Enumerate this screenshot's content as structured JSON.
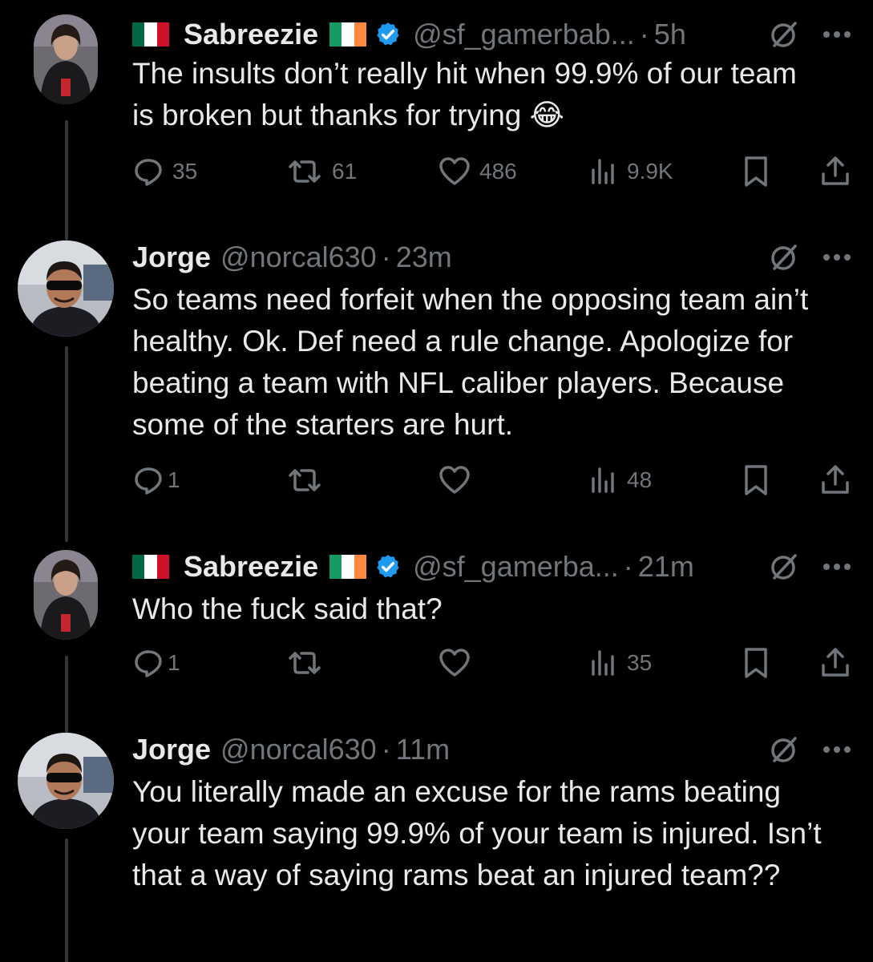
{
  "tweets": [
    {
      "display_name": "Sabreezie",
      "handle": "@sf_gamerbab...",
      "separator": "·",
      "time": "5h",
      "text": "The insults don’t really hit when 99.9% of our team is broken but thanks for trying 😂",
      "replies": "35",
      "reposts": "61",
      "likes": "486",
      "views": "9.9K"
    },
    {
      "display_name": "Jorge",
      "handle": "@norcal630",
      "separator": "·",
      "time": "23m",
      "text": "So teams need forfeit when the opposing team ain’t healthy. Ok. Def need a rule change. Apologize for beating a team with NFL caliber players. Because some of the starters are hurt.",
      "replies": "1",
      "reposts": "",
      "likes": "",
      "views": "48"
    },
    {
      "display_name": "Sabreezie",
      "handle": "@sf_gamerba...",
      "separator": "·",
      "time": "21m",
      "text": "Who the fuck said that?",
      "replies": "1",
      "reposts": "",
      "likes": "",
      "views": "35"
    },
    {
      "display_name": "Jorge",
      "handle": "@norcal630",
      "separator": "·",
      "time": "11m",
      "text": "You literally made an excuse for the rams beating your team saying 99.9% of your team is injured. Isn’t that a way of saying rams beat an injured team??"
    }
  ],
  "colors": {
    "background": "#000000",
    "text": "#e7e9ea",
    "muted": "#71767b",
    "verified": "#1d9bf0",
    "thread_line": "#333639"
  },
  "flags": {
    "left": "mexico-flag",
    "right": "ireland-flag"
  }
}
